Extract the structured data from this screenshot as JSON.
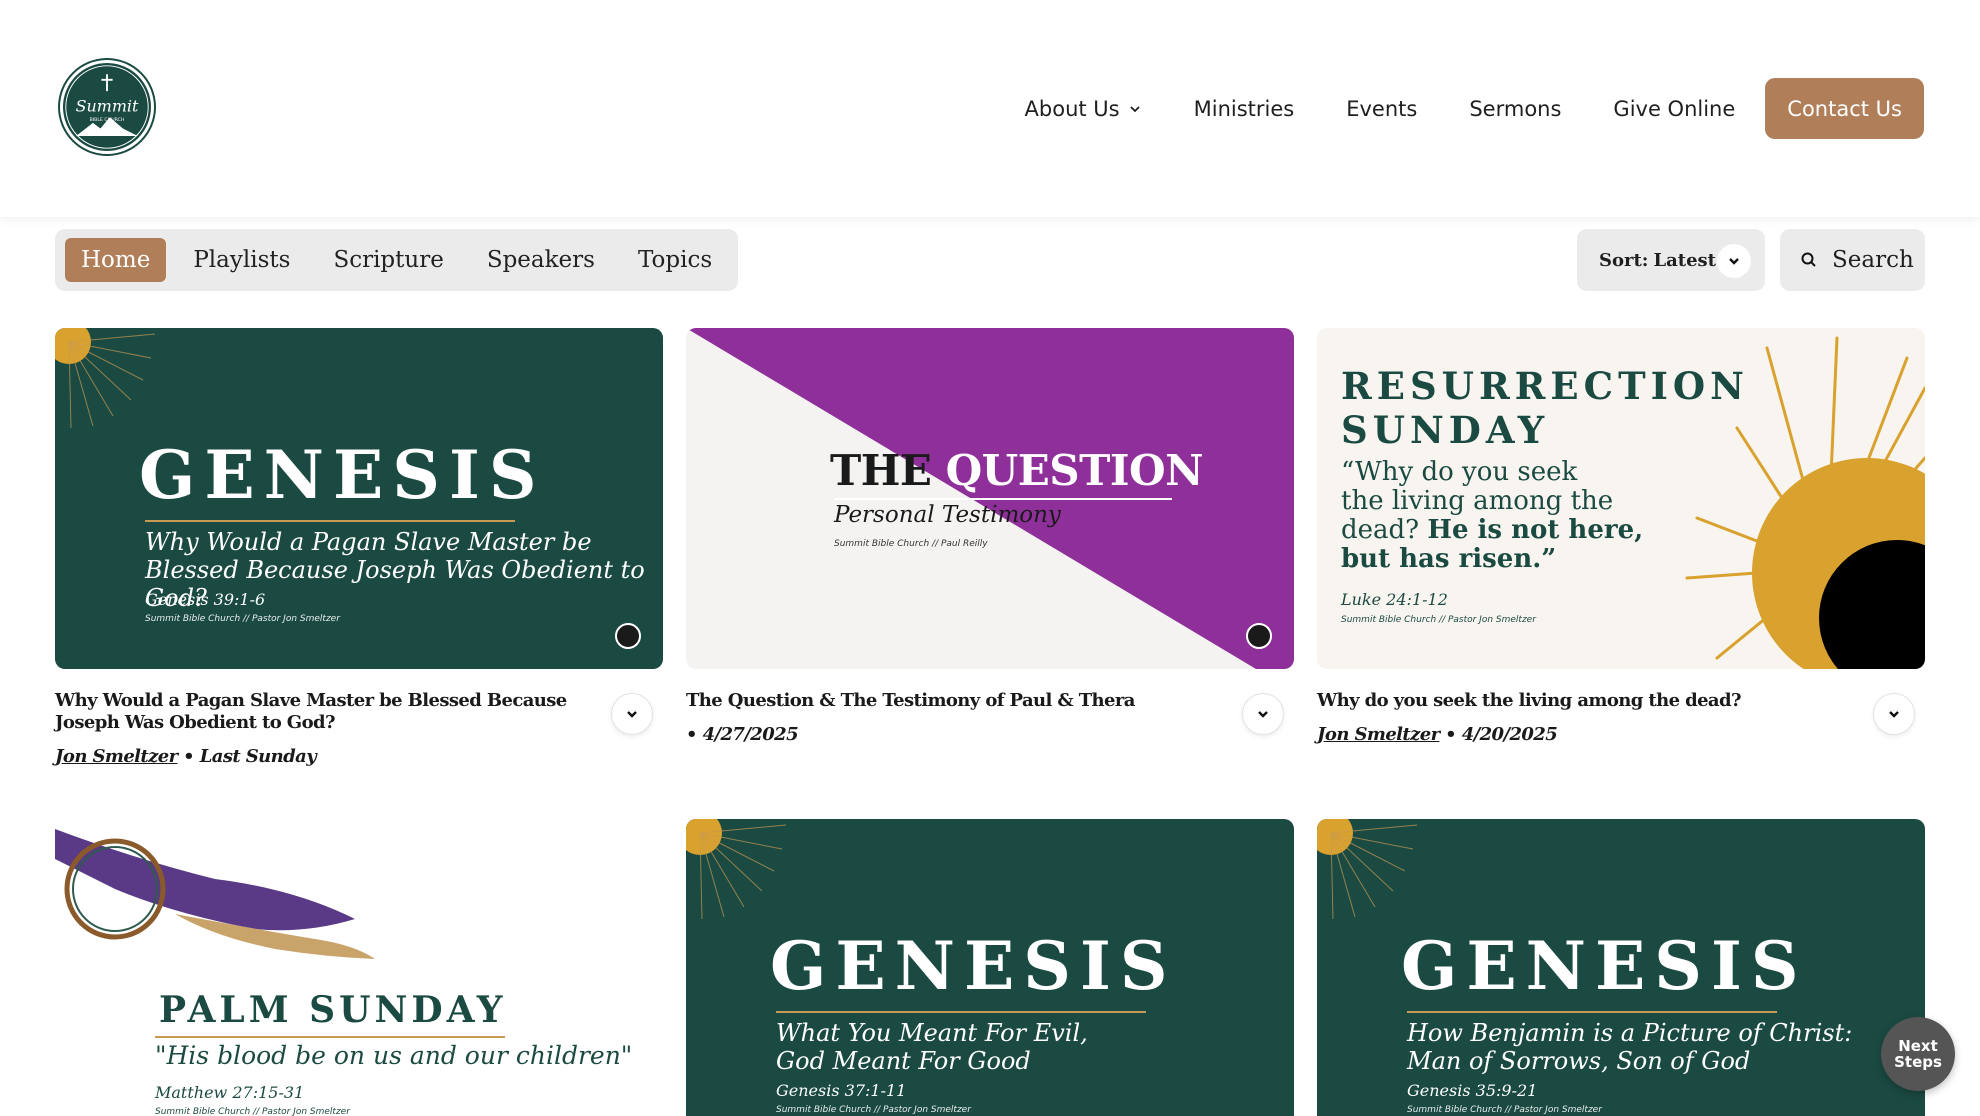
{
  "header": {
    "logo_text": "Summit",
    "logo_subtext": "BIBLE CHURCH",
    "nav": [
      {
        "label": "About Us",
        "has_dropdown": true
      },
      {
        "label": "Ministries"
      },
      {
        "label": "Events"
      },
      {
        "label": "Sermons"
      },
      {
        "label": "Give Online"
      }
    ],
    "contact_label": "Contact Us"
  },
  "tabs": {
    "items": [
      "Home",
      "Playlists",
      "Scripture",
      "Speakers",
      "Topics"
    ],
    "active": "Home"
  },
  "sort": {
    "label": "Sort:",
    "value": "Latest"
  },
  "search": {
    "label": "Search",
    "icon": "search-icon"
  },
  "sermons": [
    {
      "title": "Why Would a Pagan Slave Master be Blessed Because Joseph Was Obedient to God?",
      "speaker": "Jon Smeltzer",
      "separator": "•",
      "date": "Last Sunday",
      "thumb": {
        "series": "GENESIS",
        "subtitle": "Why Would a Pagan Slave Master be Blessed Because Joseph Was Obedient to God?",
        "reference": "Genesis 39:1-6",
        "credit": "Summit Bible Church // Pastor Jon Smeltzer"
      }
    },
    {
      "title": "The Question & The Testimony of Paul & Thera",
      "speaker": "",
      "separator": "•",
      "date": "4/27/2025",
      "thumb": {
        "series_a": "THE",
        "series_b": "QUESTION",
        "subtitle": "Personal Testimony",
        "credit": "Summit Bible Church // Paul Reilly"
      }
    },
    {
      "title": "Why do you seek the living among the dead?",
      "speaker": "Jon Smeltzer",
      "separator": "•",
      "date": "4/20/2025",
      "thumb": {
        "series_line1": "RESURRECTION",
        "series_line2": "SUNDAY",
        "quote_1": "“Why do you seek",
        "quote_2": "the living among the",
        "quote_3a": "dead? ",
        "quote_3b": "He is not here,",
        "quote_4": "but has risen.”",
        "reference": "Luke 24:1-12",
        "credit": "Summit Bible Church // Pastor Jon Smeltzer"
      }
    },
    {
      "thumb": {
        "series": "PALM SUNDAY",
        "subtitle": "\"His blood be on us and our children\"",
        "reference": "Matthew 27:15-31",
        "credit": "Summit Bible Church // Pastor Jon Smeltzer"
      }
    },
    {
      "thumb": {
        "series": "GENESIS",
        "subtitle_1": "What You Meant For Evil,",
        "subtitle_2": "God Meant For Good",
        "reference": "Genesis 37:1-11",
        "credit": "Summit Bible Church // Pastor Jon Smeltzer"
      }
    },
    {
      "thumb": {
        "series": "GENESIS",
        "subtitle_1": "How Benjamin is a Picture of Christ:",
        "subtitle_2": "Man of Sorrows, Son of God",
        "reference": "Genesis 35:9-21",
        "credit": "Summit Bible Church // Pastor Jon Smeltzer"
      }
    }
  ],
  "next_steps": {
    "line1": "Next",
    "line2": "Steps"
  },
  "colors": {
    "accent": "#b07f5a",
    "genesis_green": "#1b4a42",
    "gold": "#d9a12e",
    "purple": "#8e2f9a",
    "tab_bg": "#ebebeb"
  }
}
